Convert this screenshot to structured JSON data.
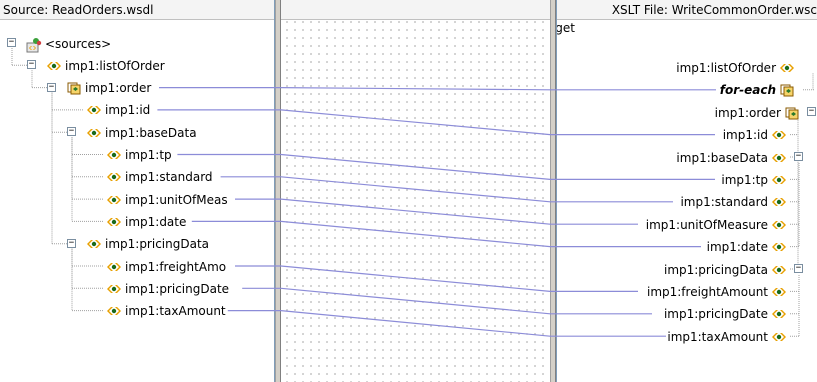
{
  "source": {
    "header": "Source: ReadOrders.wsdl",
    "nodes": [
      {
        "label": "<sources>",
        "icon": "sources-icon"
      },
      {
        "label": "imp1:listOfOrder",
        "icon": "element-icon"
      },
      {
        "label": "imp1:order",
        "icon": "repeating-element-icon"
      },
      {
        "label": "imp1:id",
        "icon": "element-icon"
      },
      {
        "label": "imp1:baseData",
        "icon": "element-icon"
      },
      {
        "label": "imp1:tp",
        "icon": "element-icon"
      },
      {
        "label": "imp1:standard",
        "icon": "element-icon"
      },
      {
        "label": "imp1:unitOfMeas",
        "icon": "element-icon"
      },
      {
        "label": "imp1:date",
        "icon": "element-icon"
      },
      {
        "label": "imp1:pricingData",
        "icon": "element-icon"
      },
      {
        "label": "imp1:freightAmo",
        "icon": "element-icon"
      },
      {
        "label": "imp1:pricingDate",
        "icon": "element-icon"
      },
      {
        "label": "imp1:taxAmount",
        "icon": "element-icon"
      }
    ]
  },
  "target": {
    "header": "XSLT File: WriteCommonOrder.wsc",
    "nodes": [
      {
        "label": "<target",
        "icon": ""
      },
      {
        "label": "imp1:listOfOrder",
        "icon": "element-icon"
      },
      {
        "label": "for-each",
        "icon": "for-each-icon"
      },
      {
        "label": "imp1:order",
        "icon": "repeating-element-icon"
      },
      {
        "label": "imp1:id",
        "icon": "element-icon"
      },
      {
        "label": "imp1:baseData",
        "icon": "element-icon"
      },
      {
        "label": "imp1:tp",
        "icon": "element-icon"
      },
      {
        "label": "imp1:standard",
        "icon": "element-icon"
      },
      {
        "label": "imp1:unitOfMeasure",
        "icon": "element-icon"
      },
      {
        "label": "imp1:date",
        "icon": "element-icon"
      },
      {
        "label": "imp1:pricingData",
        "icon": "element-icon"
      },
      {
        "label": "imp1:freightAmount",
        "icon": "element-icon"
      },
      {
        "label": "imp1:pricingDate",
        "icon": "element-icon"
      },
      {
        "label": "imp1:taxAmount",
        "icon": "element-icon"
      }
    ]
  },
  "colors": {
    "mapping_line": "#8c8cd8",
    "tree_line": "#a0a0a0",
    "element_icon_primary": "#e8a000",
    "element_icon_secondary": "#1a6a1a",
    "divider": "#d4d0c8"
  }
}
